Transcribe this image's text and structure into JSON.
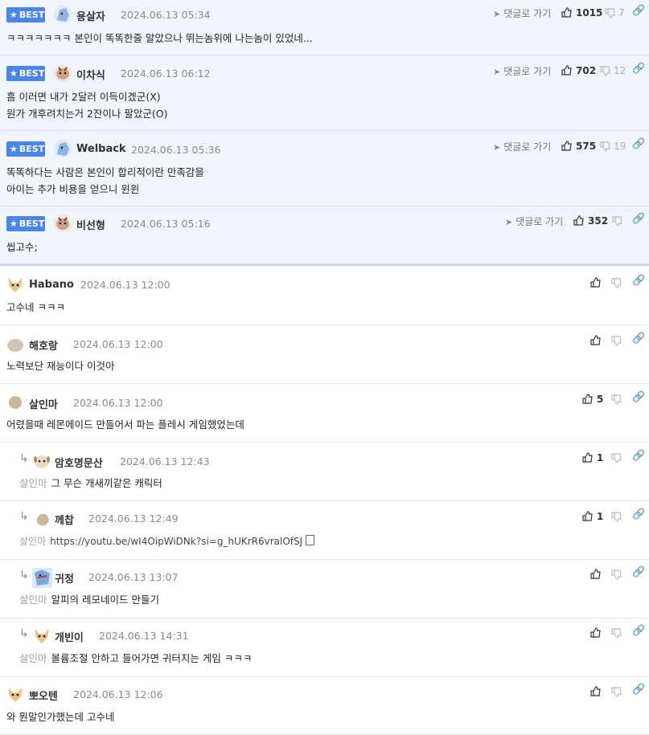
{
  "best_badge_label": "BEST",
  "goto_reply_label": "댓글로 가기",
  "best_comments": [
    {
      "nick": "용살자",
      "date": "2024.06.13 05:34",
      "lines": [
        "ㅋㅋㅋㅋㅋㅋㅋ 본인이 똑똑한줄 알았으나 뛰는놈위에 나는놈이 있었네..."
      ],
      "likes": "1015",
      "dislikes": "7"
    },
    {
      "nick": "이차식",
      "date": "2024.06.13 06:12",
      "lines": [
        "흠 이러면 내가 2달러 이득이겠군(X)",
        "원가 개후려치는거 2잔이나 팔았군(O)"
      ],
      "likes": "702",
      "dislikes": "12"
    },
    {
      "nick": "Welback",
      "date": "2024.06.13 05:36",
      "lines": [
        "똑똑하다는 사람은 본인이 합리적이란 만족감을",
        "아이는 추가 비용을 얻으니 윈윈"
      ],
      "likes": "575",
      "dislikes": "19"
    },
    {
      "nick": "비선형",
      "date": "2024.06.13 05:16",
      "lines": [
        "씹고수;"
      ],
      "likes": "352",
      "dislikes": ""
    }
  ],
  "comments": [
    {
      "nick": "Habano",
      "date": "2024.06.13 12:00",
      "text": "고수네 ㅋㅋㅋ",
      "likes": "",
      "quote": ""
    },
    {
      "nick": "해호랑",
      "date": "2024.06.13 12:00",
      "text": "노력보단 재능이다 이것아",
      "likes": "",
      "quote": ""
    },
    {
      "nick": "살인마",
      "date": "2024.06.13 12:00",
      "text": "어렸을때 레몬에이드 만들어서 파는 플레시 게임했었는데",
      "likes": "5",
      "quote": ""
    },
    {
      "nick": "암호명문산",
      "date": "2024.06.13 12:43",
      "text": "그 무슨 개새끼같은 캐릭터",
      "likes": "1",
      "quote": "살인마"
    },
    {
      "nick": "께찹",
      "date": "2024.06.13 12:49",
      "text": "https://youtu.be/wI4OipWiDNk?si=g_hUKrR6vralOfSJ",
      "likes": "1",
      "quote": "살인마"
    },
    {
      "nick": "귀정",
      "date": "2024.06.13 13:07",
      "text": "알피의 레모네이드 만들기",
      "likes": "",
      "quote": "살인마"
    },
    {
      "nick": "개빈이",
      "date": "2024.06.13 14:31",
      "text": "볼륨조절 안하고 들어가면 귀터지는 게임 ㅋㅋㅋ",
      "likes": "",
      "quote": "살인마"
    },
    {
      "nick": "뽀오텐",
      "date": "2024.06.13 12:06",
      "text": "와 뭔말인가했는데 고수네",
      "likes": "",
      "quote": ""
    }
  ],
  "colors": {
    "best_bg": "#f0f4fb",
    "badge": "#4a86e8"
  },
  "icons": [
    "star-icon",
    "thumb-up-icon",
    "thumb-down-icon",
    "link-icon",
    "send-arrow-icon",
    "reply-arrow-icon",
    "avatar-icon",
    "document-icon"
  ]
}
